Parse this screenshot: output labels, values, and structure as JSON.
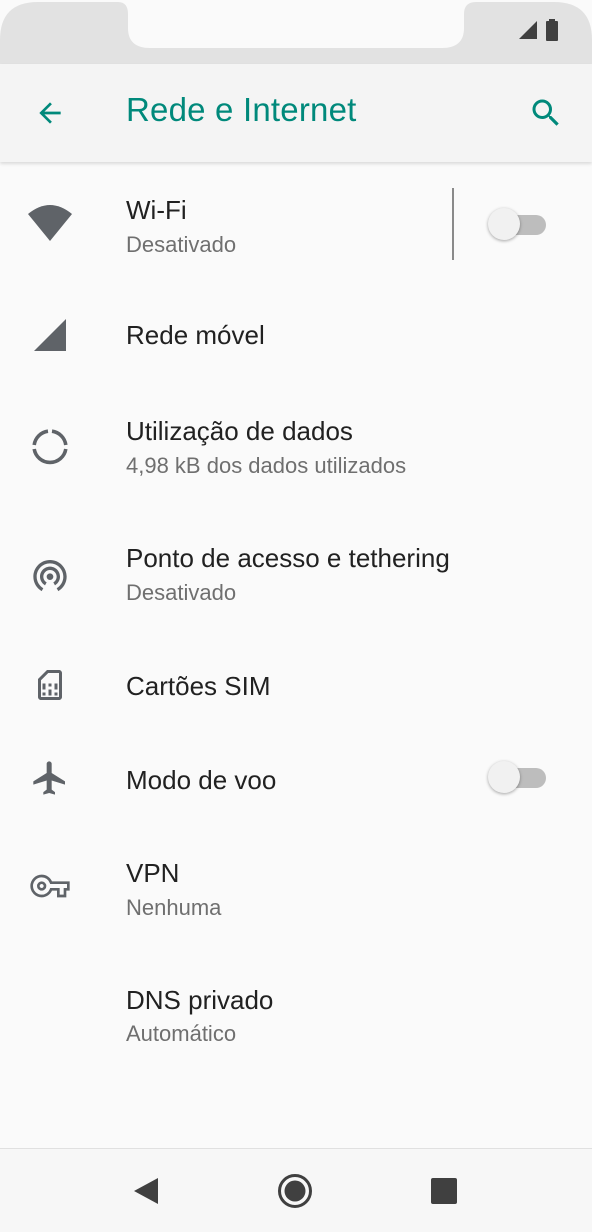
{
  "appbar": {
    "title": "Rede e Internet",
    "back_icon": "arrow-back-icon",
    "search_icon": "search-icon",
    "accent_color": "#00897b"
  },
  "settings": {
    "wifi": {
      "title": "Wi-Fi",
      "summary": "Desativado",
      "toggle_on": false
    },
    "mobile_network": {
      "title": "Rede móvel"
    },
    "data_usage": {
      "title": "Utilização de dados",
      "summary": "4,98 kB dos dados utilizados"
    },
    "hotspot": {
      "title": "Ponto de acesso e tethering",
      "summary": "Desativado"
    },
    "sim_cards": {
      "title": "Cartões SIM"
    },
    "airplane_mode": {
      "title": "Modo de voo",
      "toggle_on": false
    },
    "vpn": {
      "title": "VPN",
      "summary": "Nenhuma"
    },
    "private_dns": {
      "title": "DNS privado",
      "summary": "Automático"
    }
  },
  "navbar": {
    "back": "nav-back-icon",
    "home": "nav-home-icon",
    "recents": "nav-recents-icon"
  }
}
